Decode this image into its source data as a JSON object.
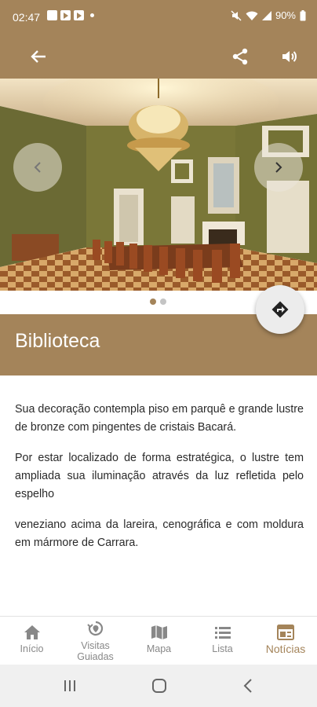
{
  "status_bar": {
    "time": "02:47",
    "battery": "90%"
  },
  "toolbar": {
    "back_icon": "arrow-left-icon",
    "share_icon": "share-icon",
    "audio_icon": "volume-icon"
  },
  "carousel": {
    "image_subject": "library-room-photo",
    "page_count": 2,
    "current_page": 1
  },
  "page": {
    "title": "Biblioteca"
  },
  "content": {
    "paragraphs": [
      "Sua decoração contempla piso em parquê e grande lustre de bronze com pingentes de cristais Bacará.",
      "Por estar localizado de forma estratégica, o lustre tem ampliada sua iluminação através da luz refletida pelo espelho",
      "veneziano acima da lareira, cenográfica e com moldura em mármore de Carrara."
    ]
  },
  "bottom_nav": {
    "items": [
      {
        "label": "Início",
        "icon": "home-icon"
      },
      {
        "label": "Visitas Guiadas",
        "icon": "guided-tour-icon"
      },
      {
        "label": "Mapa",
        "icon": "map-icon"
      },
      {
        "label": "Lista",
        "icon": "list-icon"
      },
      {
        "label": "Notícias",
        "icon": "news-icon"
      }
    ],
    "active_index": 4
  },
  "colors": {
    "brand": "#a4845a",
    "active_nav": "#a4845a",
    "inactive_nav": "#888888"
  }
}
